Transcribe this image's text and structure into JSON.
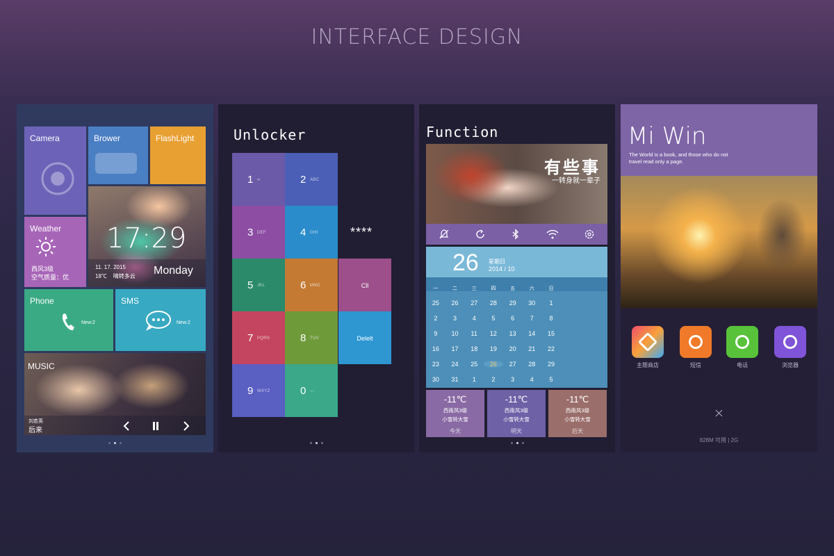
{
  "page_title": "INTERFACE DESIGN",
  "screen1": {
    "tiles": {
      "camera": "Camera",
      "browser": "Brower",
      "flashlight": "FlashLight",
      "weather": "Weather",
      "weather_line1": "西风3级",
      "weather_line2": "空气质量：优",
      "phone": "Phone",
      "phone_badge": "New:2",
      "sms": "SMS",
      "sms_badge": "New:2",
      "music": "MUSIC",
      "music_artist": "刘若英",
      "music_song": "后来"
    },
    "clock": {
      "time": "17:29",
      "date": "11. 17. 2015",
      "temp_desc": "18℃    晴转多云",
      "weekday": "Monday"
    },
    "colors": {
      "camera": "#6c63b8",
      "browser": "#4b7fc4",
      "flashlight": "#e8a033",
      "weather": "#a765b8",
      "phone": "#3aaa85",
      "sms": "#38a9c2"
    }
  },
  "screen2": {
    "title": "Unlocker",
    "pin_display": "****",
    "keys": [
      {
        "digit": "1",
        "letters": "∞",
        "color": "#6b5aa8"
      },
      {
        "digit": "2",
        "letters": "ABC",
        "color": "#4a5fb5"
      },
      {
        "digit": "3",
        "letters": "DEF",
        "color": "#8c4da3"
      },
      {
        "digit": "4",
        "letters": "GHI",
        "color": "#2a8cca"
      },
      {
        "digit": "5",
        "letters": "JKL",
        "color": "#2b8a6a"
      },
      {
        "digit": "6",
        "letters": "MNO",
        "color": "#c47a33"
      },
      {
        "digit": "7",
        "letters": "PQRS",
        "color": "#c4455f"
      },
      {
        "digit": "8",
        "letters": "TUV",
        "color": "#6f9a3a"
      },
      {
        "digit": "9",
        "letters": "WXYZ",
        "color": "#5a5fc2"
      },
      {
        "digit": "0",
        "letters": "—",
        "color": "#3aa889"
      }
    ],
    "clear_label": "Cll",
    "delete_label": "Delelt"
  },
  "screen3": {
    "title": "Function",
    "banner_title": "有些事",
    "banner_subtitle": "一转身就一辈子",
    "date_day": "26",
    "date_weekday": "星期日",
    "date_month": "2014 / 10",
    "weekdays": [
      "一",
      "二",
      "三",
      "四",
      "五",
      "六",
      "日"
    ],
    "calendar": [
      [
        "25",
        "26",
        "27",
        "28",
        "29",
        "30",
        "1"
      ],
      [
        "2",
        "3",
        "4",
        "5",
        "6",
        "7",
        "8"
      ],
      [
        "9",
        "10",
        "11",
        "12",
        "13",
        "14",
        "15"
      ],
      [
        "16",
        "17",
        "18",
        "19",
        "20",
        "21",
        "22"
      ],
      [
        "23",
        "24",
        "25",
        "26",
        "27",
        "28",
        "29"
      ],
      [
        "30",
        "31",
        "1",
        "2",
        "3",
        "4",
        "5"
      ]
    ],
    "today": "26",
    "weather": [
      {
        "temp": "-11℃",
        "wind": "西南风3级",
        "desc": "小雪转大雪",
        "day": "今天",
        "color": "#8a6aa4"
      },
      {
        "temp": "-11℃",
        "wind": "西南风3级",
        "desc": "小雪转大雪",
        "day": "明天",
        "color": "#6e61a6"
      },
      {
        "temp": "-11℃",
        "wind": "西南风3级",
        "desc": "小雪转大雪",
        "day": "后天",
        "color": "#9a6e6a"
      }
    ]
  },
  "screen4": {
    "title": "Mi Win",
    "subtitle_line1": "The World is a book, and those who do not",
    "subtitle_line2": "travel read only a page.",
    "apps": [
      {
        "label": "主题商店",
        "icon": "theme-store-icon"
      },
      {
        "label": "短信",
        "icon": "message-icon"
      },
      {
        "label": "电话",
        "icon": "phone-icon"
      },
      {
        "label": "浏览器",
        "icon": "browser-icon"
      }
    ],
    "memory": "828M 可用 | 2G"
  }
}
